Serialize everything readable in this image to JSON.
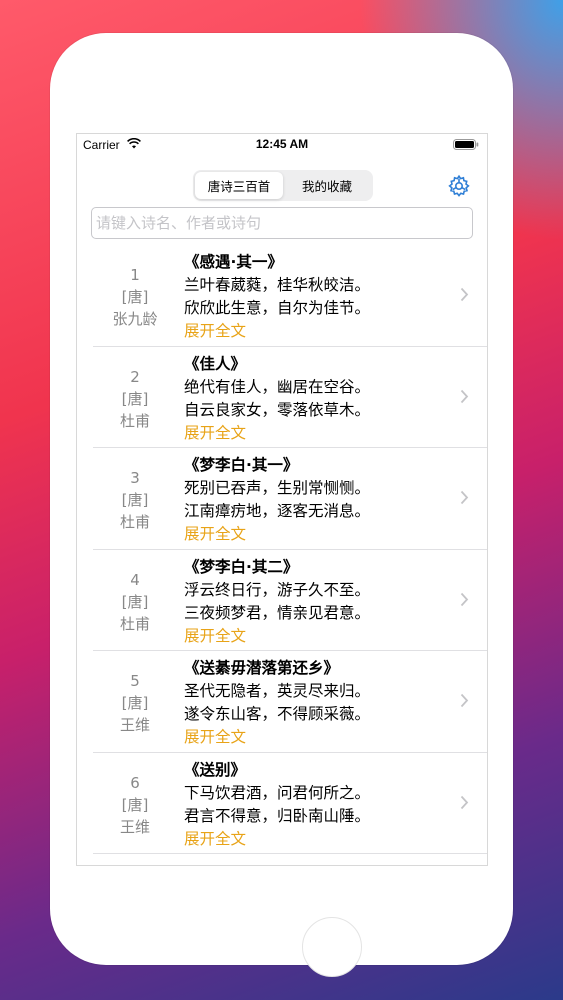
{
  "status_bar": {
    "carrier": "Carrier",
    "time": "12:45 AM"
  },
  "tabs": [
    {
      "label": "唐诗三百首",
      "active": true
    },
    {
      "label": "我的收藏",
      "active": false
    }
  ],
  "search": {
    "placeholder": "请键入诗名、作者或诗句",
    "value": ""
  },
  "expand_label": "展开全文",
  "poems": [
    {
      "index": "1",
      "dynasty": "[唐]",
      "author": "张九龄",
      "title": "《感遇·其一》",
      "line1": "兰叶春葳蕤，桂华秋皎洁。",
      "line2": "欣欣此生意，自尔为佳节。"
    },
    {
      "index": "2",
      "dynasty": "[唐]",
      "author": "杜甫",
      "title": "《佳人》",
      "line1": "绝代有佳人，幽居在空谷。",
      "line2": "自云良家女，零落依草木。"
    },
    {
      "index": "3",
      "dynasty": "[唐]",
      "author": "杜甫",
      "title": "《梦李白·其一》",
      "line1": "死别已吞声，生别常恻恻。",
      "line2": "江南瘴疠地，逐客无消息。"
    },
    {
      "index": "4",
      "dynasty": "[唐]",
      "author": "杜甫",
      "title": "《梦李白·其二》",
      "line1": "浮云终日行，游子久不至。",
      "line2": "三夜频梦君，情亲见君意。"
    },
    {
      "index": "5",
      "dynasty": "[唐]",
      "author": "王维",
      "title": "《送綦毋潜落第还乡》",
      "line1": "圣代无隐者，英灵尽来归。",
      "line2": "遂令东山客，不得顾采薇。"
    },
    {
      "index": "6",
      "dynasty": "[唐]",
      "author": "王维",
      "title": "《送别》",
      "line1": "下马饮君酒，问君何所之。",
      "line2": "君言不得意，归卧南山陲。"
    }
  ],
  "colors": {
    "accent": "#2f7fd6",
    "expand": "#e8a317",
    "meta": "#888888"
  }
}
